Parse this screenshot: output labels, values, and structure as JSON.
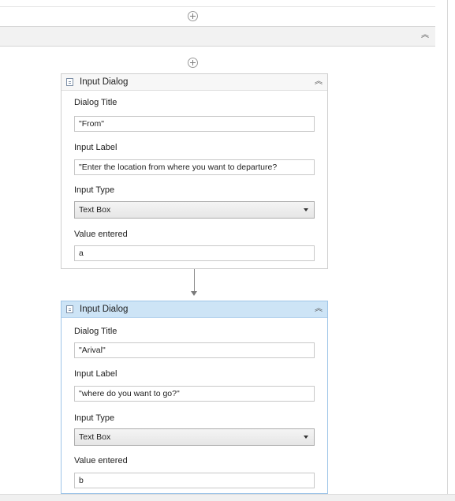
{
  "activities": [
    {
      "title": "Input Dialog",
      "dialog_title_label": "Dialog Title",
      "dialog_title_value": "\"From\"",
      "input_label_label": "Input Label",
      "input_label_value": "\"Enter the location from where you want to departure?",
      "input_type_label": "Input Type",
      "input_type_value": "Text Box",
      "value_entered_label": "Value entered",
      "value_entered_value": "a"
    },
    {
      "title": "Input Dialog",
      "dialog_title_label": "Dialog Title",
      "dialog_title_value": "\"Arival\"",
      "input_label_label": "Input Label",
      "input_label_value": "\"where do you want to go?\"",
      "input_type_label": "Input Type",
      "input_type_value": "Text Box",
      "value_entered_label": "Value entered",
      "value_entered_value": "b"
    }
  ],
  "icons": {
    "add": "plus-circle-icon",
    "collapse": "double-chevron-up-icon",
    "activity": "input-dialog-icon",
    "dropdown": "caret-down-icon"
  },
  "colors": {
    "selected_header": "#cde4f6",
    "selected_border": "#9ec5e8"
  }
}
